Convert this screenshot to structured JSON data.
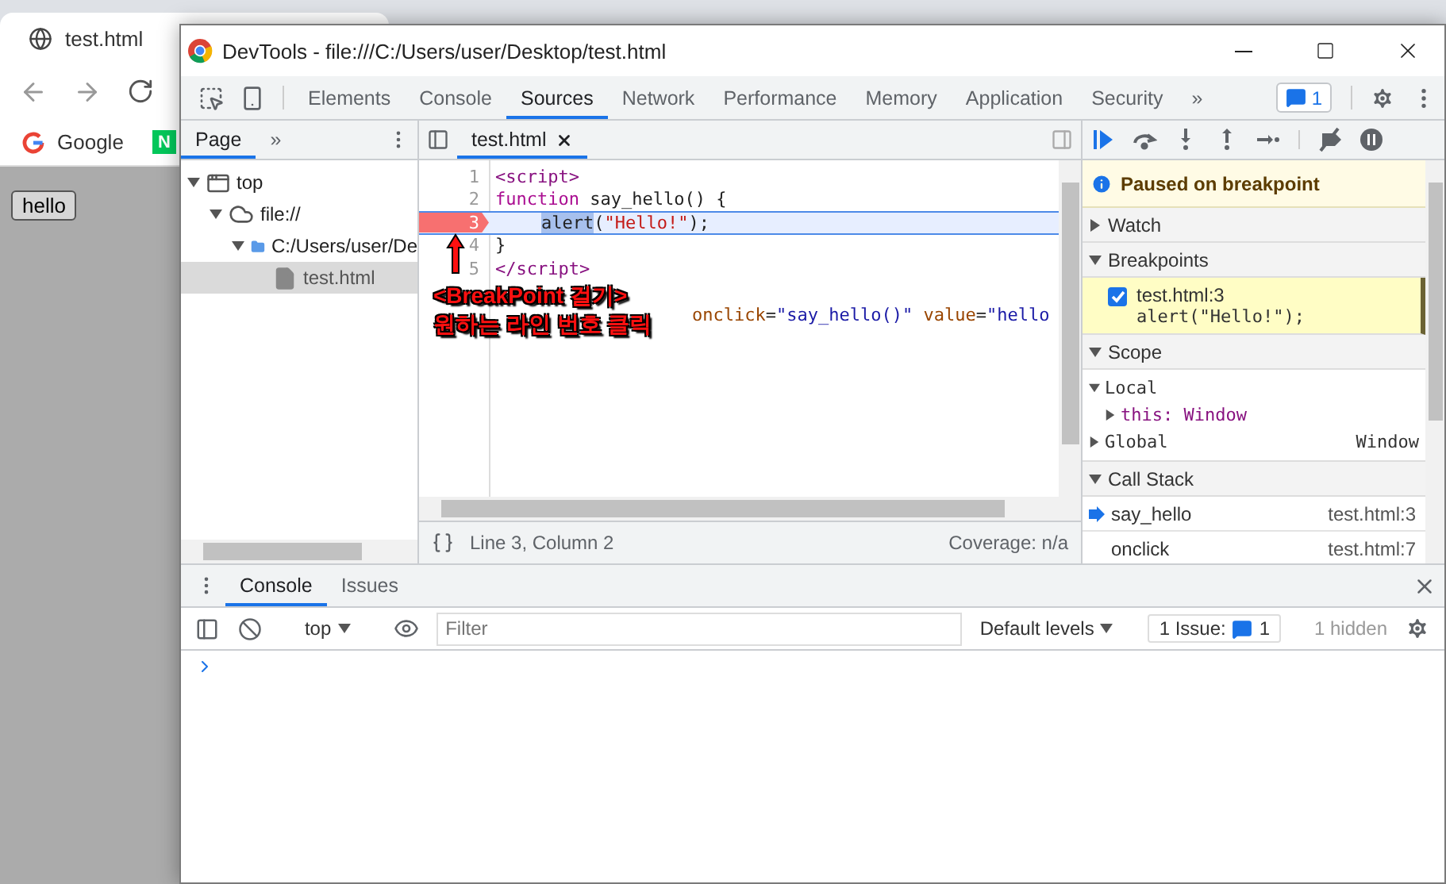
{
  "browser": {
    "tab_title": "test.html",
    "bookmarks": [
      {
        "kind": "google",
        "label": "Google"
      },
      {
        "kind": "naver",
        "label": "N"
      }
    ],
    "page_button": "hello"
  },
  "devtools": {
    "title": "DevTools - file:///C:/Users/user/Desktop/test.html",
    "main_tabs": [
      {
        "label": "Elements",
        "selected": false
      },
      {
        "label": "Console",
        "selected": false
      },
      {
        "label": "Sources",
        "selected": true
      },
      {
        "label": "Network",
        "selected": false
      },
      {
        "label": "Performance",
        "selected": false
      },
      {
        "label": "Memory",
        "selected": false
      },
      {
        "label": "Application",
        "selected": false
      },
      {
        "label": "Security",
        "selected": false
      }
    ],
    "more_tabs": "»",
    "issues_count": "1",
    "navigator": {
      "tabs": [
        {
          "label": "Page",
          "selected": true
        }
      ],
      "more": "»",
      "tree": [
        {
          "kind": "frame",
          "label": "top",
          "expanded": true,
          "selected": false,
          "children": [
            {
              "kind": "origin",
              "label": "file://",
              "expanded": true,
              "selected": false,
              "children": [
                {
                  "kind": "folder",
                  "label": "C:/Users/user/De",
                  "expanded": true,
                  "selected": false,
                  "children": [
                    {
                      "kind": "file",
                      "label": "test.html",
                      "selected": true
                    }
                  ]
                }
              ]
            }
          ]
        }
      ]
    },
    "editor": {
      "file_tabs": [
        {
          "label": "test.html",
          "selected": true
        }
      ],
      "lines": [
        {
          "number": "1",
          "covered": false,
          "indented": false,
          "breakpoint": false,
          "current": false,
          "tokens": [
            {
              "kind": "tag",
              "text": "<script>"
            }
          ]
        },
        {
          "number": "2",
          "covered": false,
          "indented": false,
          "breakpoint": false,
          "current": false,
          "tokens": [
            {
              "kind": "keyword",
              "text": "function"
            },
            {
              "kind": "plain",
              "text": " say_hello() {"
            }
          ]
        },
        {
          "number": "3",
          "covered": false,
          "indented": true,
          "breakpoint": true,
          "current": true,
          "tokens": [
            {
              "kind": "highlight",
              "text": "alert"
            },
            {
              "kind": "plain",
              "text": "("
            },
            {
              "kind": "string",
              "text": "\"Hello!\""
            },
            {
              "kind": "plain",
              "text": ");"
            }
          ]
        },
        {
          "number": "4",
          "covered": false,
          "indented": false,
          "breakpoint": false,
          "current": false,
          "tokens": [
            {
              "kind": "plain",
              "text": "}"
            }
          ]
        },
        {
          "number": "5",
          "covered": false,
          "indented": false,
          "breakpoint": false,
          "current": false,
          "tokens": [
            {
              "kind": "tag",
              "text": "</script>"
            }
          ]
        },
        {
          "covered": true,
          "indented": false,
          "breakpoint": false,
          "current": false,
          "tokens": [
            {
              "kind": "attr",
              "text": "onclick"
            },
            {
              "kind": "plain",
              "text": "="
            },
            {
              "kind": "value",
              "text": "\"say_hello()\" "
            },
            {
              "kind": "attr",
              "text": "value"
            },
            {
              "kind": "plain",
              "text": "="
            },
            {
              "kind": "value",
              "text": "\"hello"
            }
          ]
        }
      ],
      "annotation": [
        "<BreakPoint 걸기>",
        "원하는 라인 번호 클릭"
      ],
      "position": "Line 3, Column 2",
      "coverage": "Coverage: n/a"
    },
    "debugger": {
      "paused_message": "Paused on breakpoint",
      "sections": [
        {
          "kind": "watch",
          "title": "Watch",
          "expanded": false
        },
        {
          "kind": "breakpoints",
          "title": "Breakpoints",
          "expanded": true,
          "items": [
            {
              "location": "test.html:3",
              "code": "alert(\"Hello!\");",
              "checked": true
            }
          ]
        },
        {
          "kind": "scope",
          "title": "Scope",
          "expanded": true,
          "scopes": [
            {
              "name": "Local",
              "expanded": true,
              "children": [
                {
                  "name": "this: Window",
                  "expanded": false
                }
              ]
            },
            {
              "name": "Global",
              "value": "Window",
              "expanded": false
            }
          ]
        },
        {
          "kind": "callstack",
          "title": "Call Stack",
          "expanded": true,
          "frames": [
            {
              "name": "say_hello",
              "location": "test.html:3",
              "current": true
            },
            {
              "name": "onclick",
              "location": "test.html:7",
              "current": false
            }
          ]
        }
      ]
    },
    "drawer": {
      "tabs": [
        {
          "label": "Console",
          "selected": true
        },
        {
          "label": "Issues",
          "selected": false
        }
      ],
      "context": "top",
      "filter_placeholder": "Filter",
      "levels": "Default levels",
      "issues_label": "1 Issue:",
      "issues_count": "1",
      "hidden": "1 hidden"
    }
  }
}
